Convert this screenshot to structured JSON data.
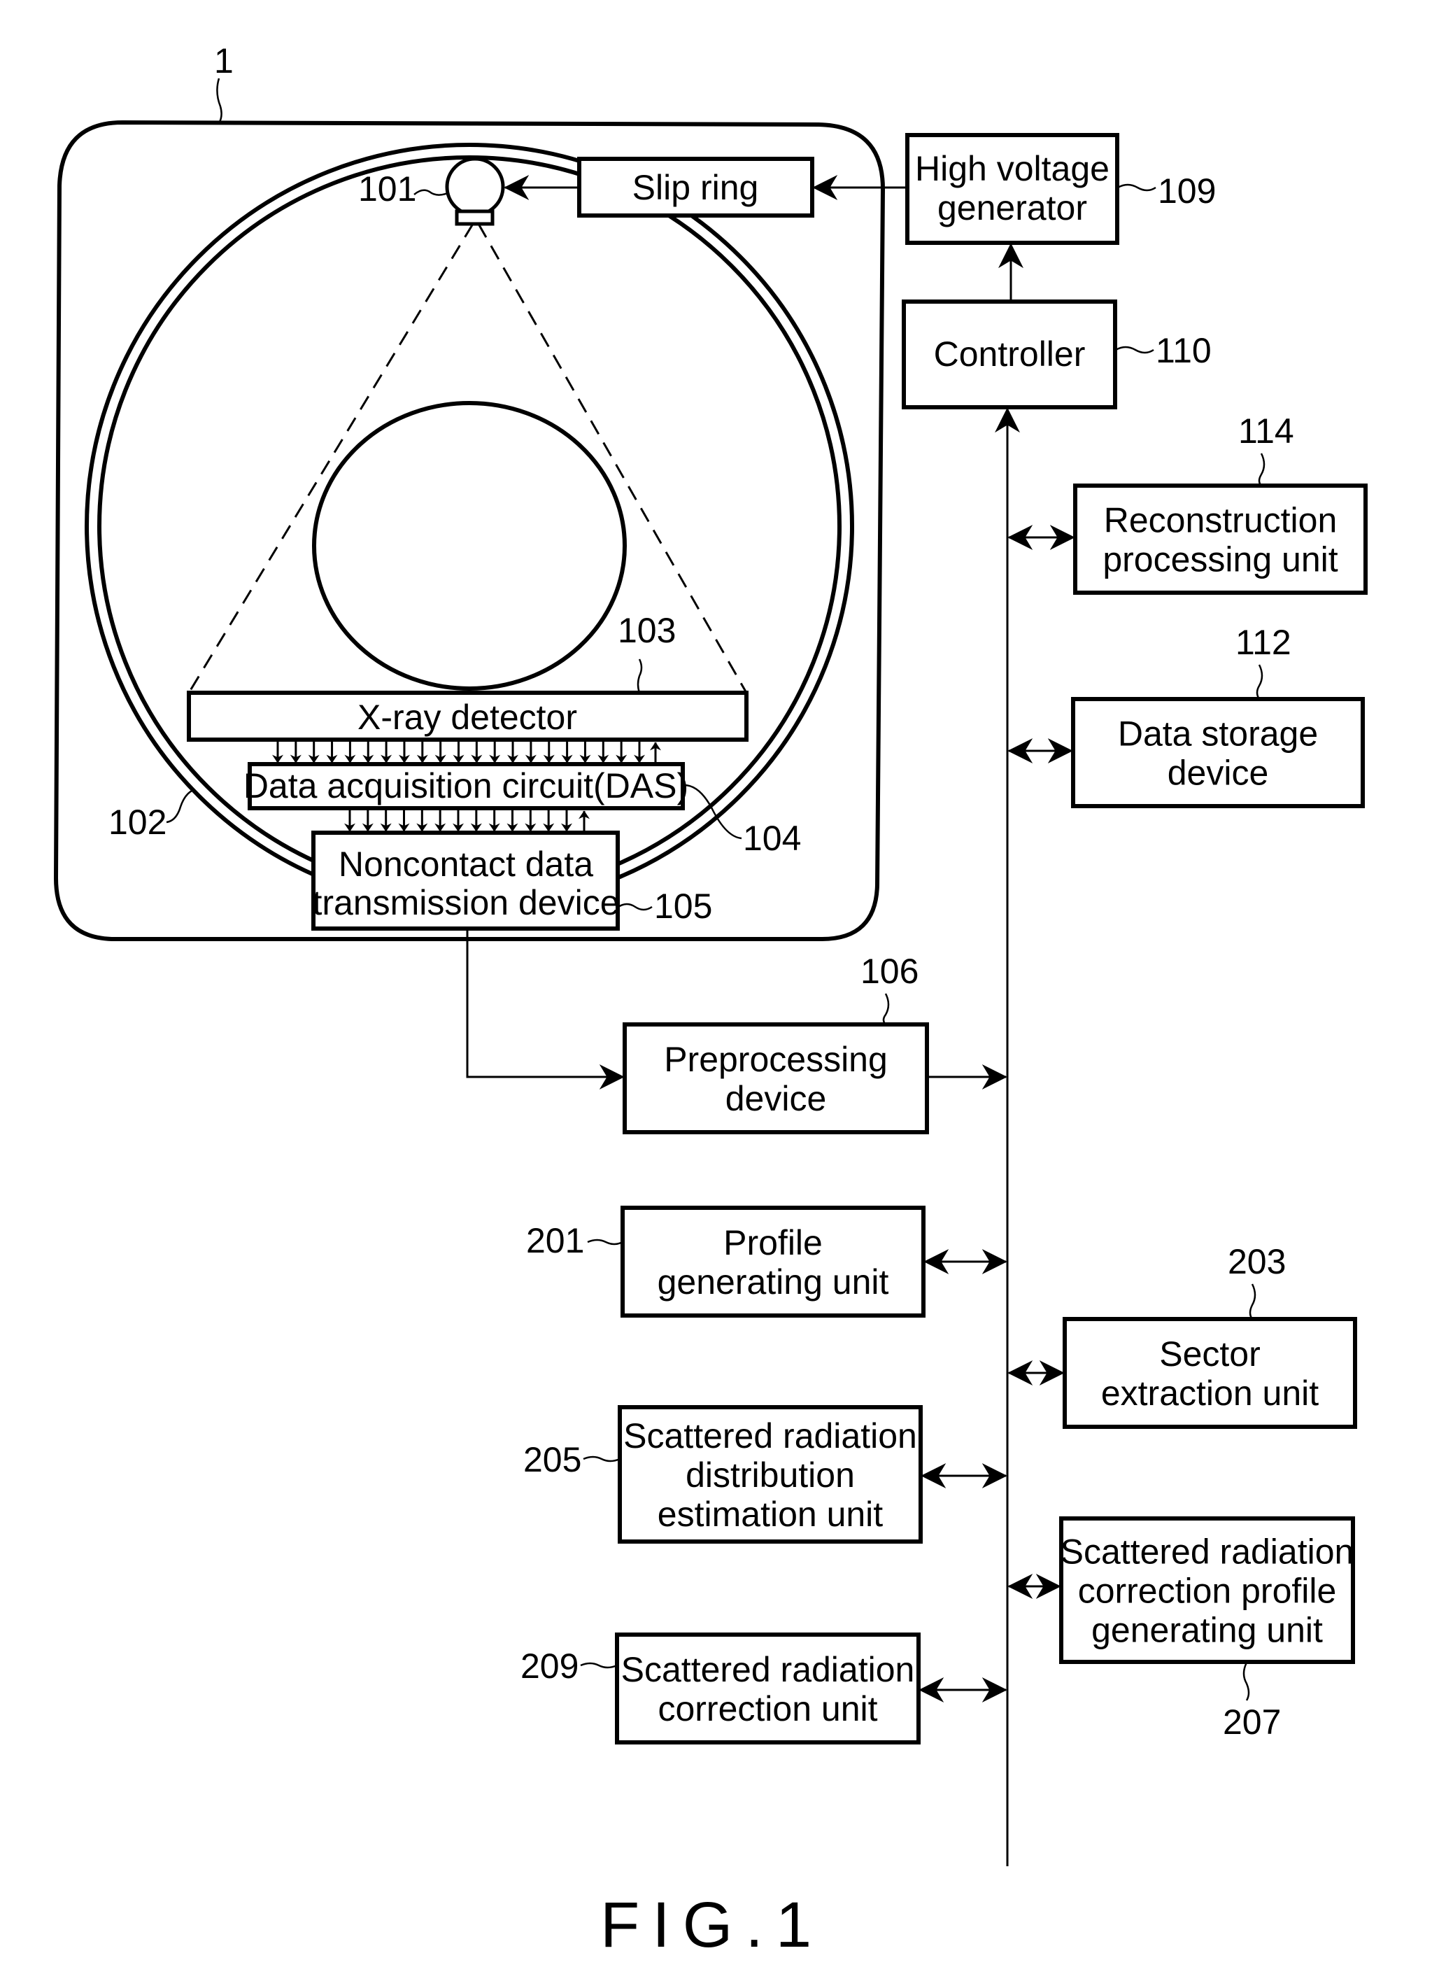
{
  "figure": {
    "caption": "FIG.1",
    "gantry_ref": "1"
  },
  "gantry": {
    "xray_tube": {
      "ref": "101"
    },
    "rotating_frame": {
      "ref": "102"
    },
    "slip_ring": {
      "label": "Slip ring"
    },
    "xray_detector": {
      "label": "X-ray detector",
      "ref": "103"
    },
    "das": {
      "label": "Data acquisition circuit(DAS)",
      "ref": "104"
    },
    "noncontact": {
      "lines": [
        "Noncontact data",
        "transmission device"
      ],
      "ref": "105"
    }
  },
  "blocks": {
    "high_voltage_generator": {
      "lines": [
        "High voltage",
        "generator"
      ],
      "ref": "109"
    },
    "controller": {
      "lines": [
        "Controller"
      ],
      "ref": "110"
    },
    "reconstruction": {
      "lines": [
        "Reconstruction",
        "processing unit"
      ],
      "ref": "114"
    },
    "data_storage": {
      "lines": [
        "Data storage",
        "device"
      ],
      "ref": "112"
    },
    "preprocessing": {
      "lines": [
        "Preprocessing",
        "device"
      ],
      "ref": "106"
    },
    "profile_generating": {
      "lines": [
        "Profile",
        "generating unit"
      ],
      "ref": "201"
    },
    "sector_extraction": {
      "lines": [
        "Sector",
        "extraction unit"
      ],
      "ref": "203"
    },
    "scatter_distribution": {
      "lines": [
        "Scattered radiation",
        "distribution",
        "estimation unit"
      ],
      "ref": "205"
    },
    "scatter_correction_profile": {
      "lines": [
        "Scattered radiation",
        "correction profile",
        "generating unit"
      ],
      "ref": "207"
    },
    "scatter_correction": {
      "lines": [
        "Scattered radiation",
        "correction unit"
      ],
      "ref": "209"
    }
  },
  "connections": [
    {
      "from": "high_voltage_generator",
      "to": "slip_ring",
      "type": "arrow"
    },
    {
      "from": "slip_ring",
      "to": "xray_tube",
      "type": "arrow"
    },
    {
      "from": "controller",
      "to": "high_voltage_generator",
      "type": "arrow"
    },
    {
      "from": "bus",
      "to": "controller",
      "type": "arrow"
    },
    {
      "from": "xray_detector",
      "to": "das",
      "type": "multi-arrow",
      "down_count": 21,
      "up_count": 1
    },
    {
      "from": "das",
      "to": "noncontact",
      "type": "multi-arrow",
      "down_count": 13,
      "up_count": 1
    },
    {
      "from": "noncontact",
      "to": "preprocessing",
      "type": "arrow"
    },
    {
      "from": "preprocessing",
      "to": "bus",
      "type": "arrow"
    },
    {
      "from": "bus",
      "to": "reconstruction",
      "type": "bidirectional"
    },
    {
      "from": "bus",
      "to": "data_storage",
      "type": "bidirectional"
    },
    {
      "from": "bus",
      "to": "profile_generating",
      "type": "bidirectional"
    },
    {
      "from": "bus",
      "to": "sector_extraction",
      "type": "bidirectional"
    },
    {
      "from": "bus",
      "to": "scatter_distribution",
      "type": "bidirectional"
    },
    {
      "from": "bus",
      "to": "scatter_correction_profile",
      "type": "bidirectional"
    },
    {
      "from": "bus",
      "to": "scatter_correction",
      "type": "bidirectional"
    }
  ]
}
